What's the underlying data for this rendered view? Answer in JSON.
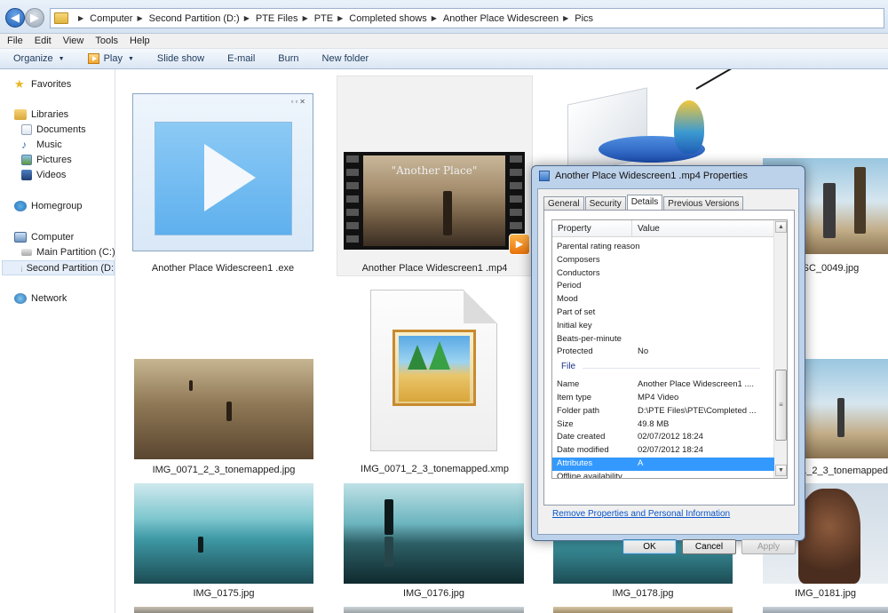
{
  "breadcrumb": [
    "Computer",
    "Second Partition (D:)",
    "PTE Files",
    "PTE",
    "Completed shows",
    "Another Place Widescreen",
    "Pics"
  ],
  "menu": [
    "File",
    "Edit",
    "View",
    "Tools",
    "Help"
  ],
  "toolbar": {
    "organize": "Organize",
    "play": "Play",
    "slideshow": "Slide show",
    "email": "E-mail",
    "burn": "Burn",
    "newfolder": "New folder"
  },
  "nav": {
    "favorites": "Favorites",
    "libraries": "Libraries",
    "documents": "Documents",
    "music": "Music",
    "pictures": "Pictures",
    "videos": "Videos",
    "homegroup": "Homegroup",
    "computer": "Computer",
    "main_partition": "Main Partition (C:)",
    "second_partition": "Second Partition (D:",
    "network": "Network"
  },
  "files": {
    "exe": "Another Place Widescreen1 .exe",
    "mp4": "Another Place Widescreen1 .mp4",
    "mp4_thumb_title": "\"Another Place\"",
    "dsc0049": "DSC_0049.jpg",
    "img0071jpg": "IMG_0071_2_3_tonemapped.jpg",
    "img0071xmp": "IMG_0071_2_3_tonemapped.xmp",
    "img0091": "_0091_2_3_tonemapped",
    "img0175": "IMG_0175.jpg",
    "img0176": "IMG_0176.jpg",
    "img0178": "IMG_0178.jpg",
    "img0181": "IMG_0181.jpg"
  },
  "dialog": {
    "title": "Another Place Widescreen1 .mp4 Properties",
    "tabs": [
      "General",
      "Security",
      "Details",
      "Previous Versions"
    ],
    "col_property": "Property",
    "col_value": "Value",
    "rows_media": [
      {
        "p": "Parental rating reason",
        "v": ""
      },
      {
        "p": "Composers",
        "v": ""
      },
      {
        "p": "Conductors",
        "v": ""
      },
      {
        "p": "Period",
        "v": ""
      },
      {
        "p": "Mood",
        "v": ""
      },
      {
        "p": "Part of set",
        "v": ""
      },
      {
        "p": "Initial key",
        "v": ""
      },
      {
        "p": "Beats-per-minute",
        "v": ""
      },
      {
        "p": "Protected",
        "v": "No"
      }
    ],
    "section_file": "File",
    "rows_file": [
      {
        "p": "Name",
        "v": "Another Place Widescreen1 ...."
      },
      {
        "p": "Item type",
        "v": "MP4 Video"
      },
      {
        "p": "Folder path",
        "v": "D:\\PTE Files\\PTE\\Completed ..."
      },
      {
        "p": "Size",
        "v": "49.8 MB"
      },
      {
        "p": "Date created",
        "v": "02/07/2012 18:24"
      },
      {
        "p": "Date modified",
        "v": "02/07/2012 18:24"
      },
      {
        "p": "Attributes",
        "v": "A"
      },
      {
        "p": "Offline availability",
        "v": ""
      }
    ],
    "link": "Remove Properties and Personal Information",
    "ok": "OK",
    "cancel": "Cancel",
    "apply": "Apply"
  }
}
